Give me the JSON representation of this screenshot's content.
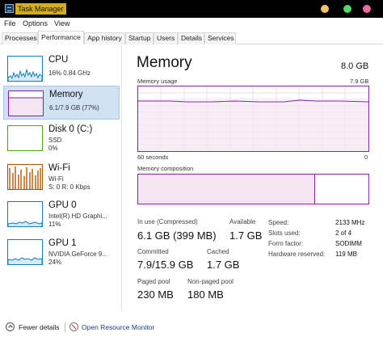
{
  "window": {
    "title": "Task Manager"
  },
  "menu": [
    "File",
    "Options",
    "View"
  ],
  "tabs": [
    "Processes",
    "Performance",
    "App history",
    "Startup",
    "Users",
    "Details",
    "Services"
  ],
  "active_tab": "Performance",
  "sidebar": {
    "items": [
      {
        "title": "CPU",
        "sub1": "16% 0.84 GHz",
        "sub2": "",
        "sub3": "",
        "color": "#117dbb",
        "icon": "cpu-graph"
      },
      {
        "title": "Memory",
        "sub1": "6.1/7.9 GB (77%)",
        "sub2": "",
        "sub3": "",
        "color": "#8b1fa3",
        "icon": "memory-graph"
      },
      {
        "title": "Disk 0 (C:)",
        "sub1": "SSD",
        "sub2": "0%",
        "sub3": "",
        "color": "#4da60c",
        "icon": "disk-graph"
      },
      {
        "title": "Wi-Fi",
        "sub1": "Wi-Fi",
        "sub2": "S: 0  R: 0 Kbps",
        "sub3": "",
        "color": "#a74f01",
        "icon": "wifi-graph"
      },
      {
        "title": "GPU 0",
        "sub1": "Intel(R) HD Graphi...",
        "sub2": "11%",
        "sub3": "",
        "color": "#117dbb",
        "icon": "gpu-graph"
      },
      {
        "title": "GPU 1",
        "sub1": "NVIDIA GeForce 9...",
        "sub2": "24%",
        "sub3": "",
        "color": "#117dbb",
        "icon": "gpu-graph"
      }
    ]
  },
  "main": {
    "title": "Memory",
    "total": "8.0 GB",
    "usage_label": "Memory usage",
    "usage_max": "7.9 GB",
    "time_left": "60 seconds",
    "time_right": "0",
    "composition_label": "Memory composition",
    "in_use_fraction": 0.77,
    "stats": {
      "in_use_label": "In use (Compressed)",
      "in_use_value": "6.1 GB (399 MB)",
      "available_label": "Available",
      "available_value": "1.7 GB",
      "committed_label": "Committed",
      "committed_value": "7.9/15.9 GB",
      "cached_label": "Cached",
      "cached_value": "1.7 GB",
      "paged_label": "Paged pool",
      "paged_value": "230 MB",
      "nonpaged_label": "Non-paged pool",
      "nonpaged_value": "180 MB"
    },
    "details": [
      {
        "label": "Speed:",
        "value": "2133 MHz"
      },
      {
        "label": "Slots used:",
        "value": "2 of 4"
      },
      {
        "label": "Form factor:",
        "value": "SODIMM"
      },
      {
        "label": "Hardware reserved:",
        "value": "119 MB"
      }
    ]
  },
  "footer": {
    "fewer_details": "Fewer details",
    "open_resource_monitor": "Open Resource Monitor",
    "link_color": "#1a3e8a"
  },
  "colors": {
    "memory": "#8b1fa3",
    "cpu": "#117dbb",
    "disk": "#4da60c",
    "wifi": "#a74f01",
    "selected": "#cfe1f3"
  }
}
